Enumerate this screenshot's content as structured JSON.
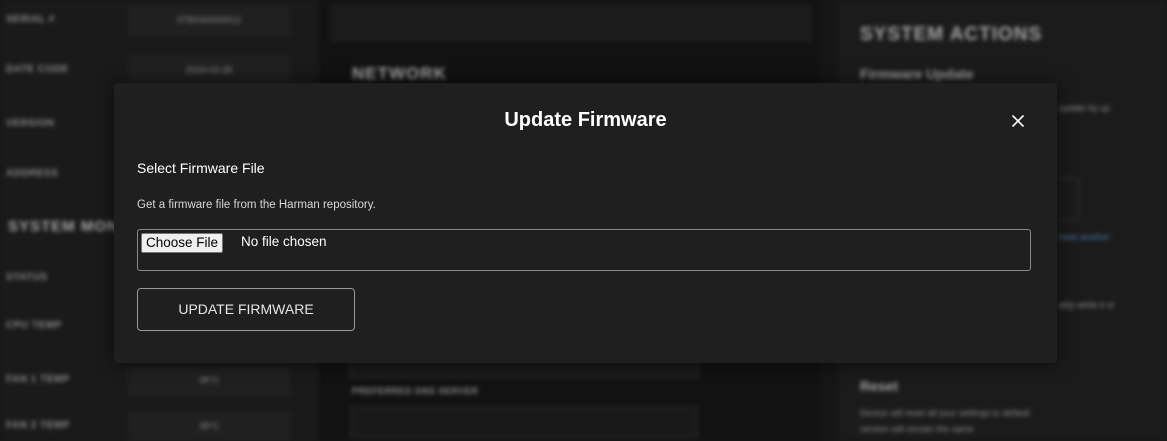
{
  "background": {
    "left_rows": [
      {
        "label": "SERIAL #",
        "value": "0TBXA0000012"
      },
      {
        "label": "DATE CODE",
        "value": "2024-03-28"
      },
      {
        "label": "VERSION",
        "value": ""
      },
      {
        "label": "ADDRESS",
        "value": ""
      }
    ],
    "left_section": "SYSTEM MONITORING",
    "left_rows_lower": [
      {
        "label": "STATUS",
        "value": ""
      },
      {
        "label": "CPU TEMP",
        "value": ""
      },
      {
        "label": "FAN 1 TEMP",
        "value": "38°C"
      },
      {
        "label": "FAN 2 TEMP",
        "value": "38°C"
      }
    ],
    "mid_title": "NETWORK",
    "mid_label": "PREFERRED DNS SERVER",
    "right_title": "SYSTEM ACTIONS",
    "right_subtitle": "Firmware Update",
    "right_text_1": "update by up",
    "right_text_2": "ably while it st",
    "right_link": "have another",
    "reset_title": "Reset",
    "reset_text_1": "Device will reset all your settings to default",
    "reset_text_2": "version will remain the same"
  },
  "modal": {
    "title": "Update Firmware",
    "section_label": "Select Firmware File",
    "hint": "Get a firmware file from the Harman repository.",
    "choose_file_label": "Choose File",
    "no_file_text": "No file chosen",
    "update_button_label": "UPDATE FIRMWARE",
    "close_icon": "close-icon"
  }
}
